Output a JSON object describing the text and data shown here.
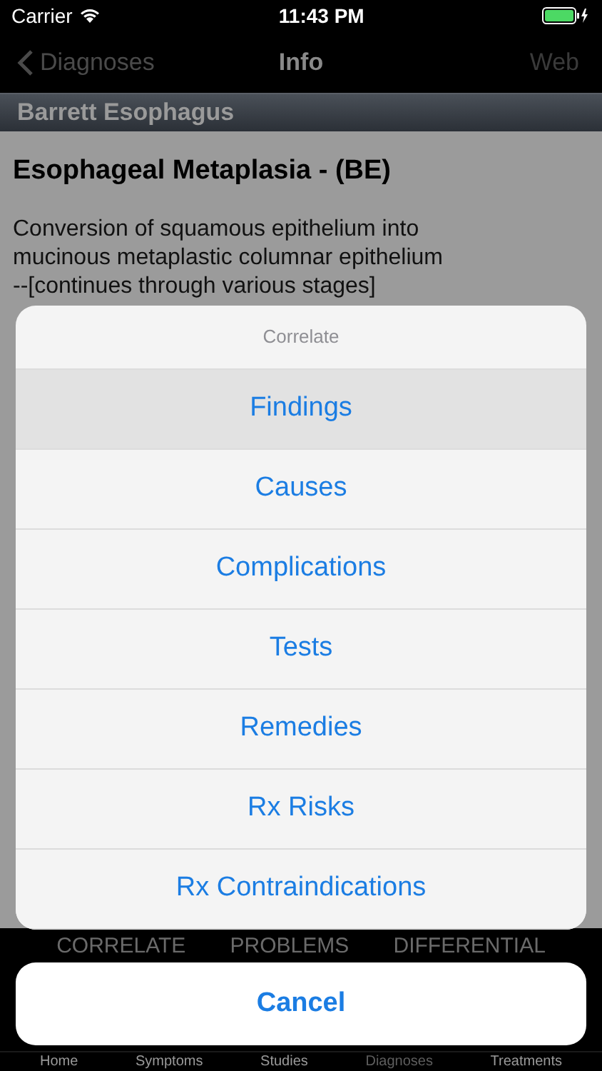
{
  "status_bar": {
    "carrier": "Carrier",
    "time": "11:43 PM"
  },
  "nav": {
    "back": "Diagnoses",
    "title": "Info",
    "action": "Web"
  },
  "section_header": "Barrett Esophagus",
  "article": {
    "title": "Esophageal Metaplasia - (BE)",
    "lines": [
      "Conversion of squamous epithelium into",
      "mucinous metaplastic columnar epithelium",
      "--[continues through various stages]"
    ]
  },
  "segments": [
    "CORRELATE",
    "PROBLEMS",
    "DIFFERENTIAL"
  ],
  "tab_bar": [
    {
      "label": "Home",
      "selected": false
    },
    {
      "label": "Symptoms",
      "selected": false
    },
    {
      "label": "Studies",
      "selected": false
    },
    {
      "label": "Diagnoses",
      "selected": true
    },
    {
      "label": "Treatments",
      "selected": false
    }
  ],
  "action_sheet": {
    "title": "Correlate",
    "items": [
      {
        "label": "Findings",
        "highlighted": true
      },
      {
        "label": "Causes",
        "highlighted": false
      },
      {
        "label": "Complications",
        "highlighted": false
      },
      {
        "label": "Tests",
        "highlighted": false
      },
      {
        "label": "Remedies",
        "highlighted": false
      },
      {
        "label": "Rx Risks",
        "highlighted": false
      },
      {
        "label": "Rx Contraindications",
        "highlighted": false
      }
    ],
    "cancel": "Cancel"
  }
}
